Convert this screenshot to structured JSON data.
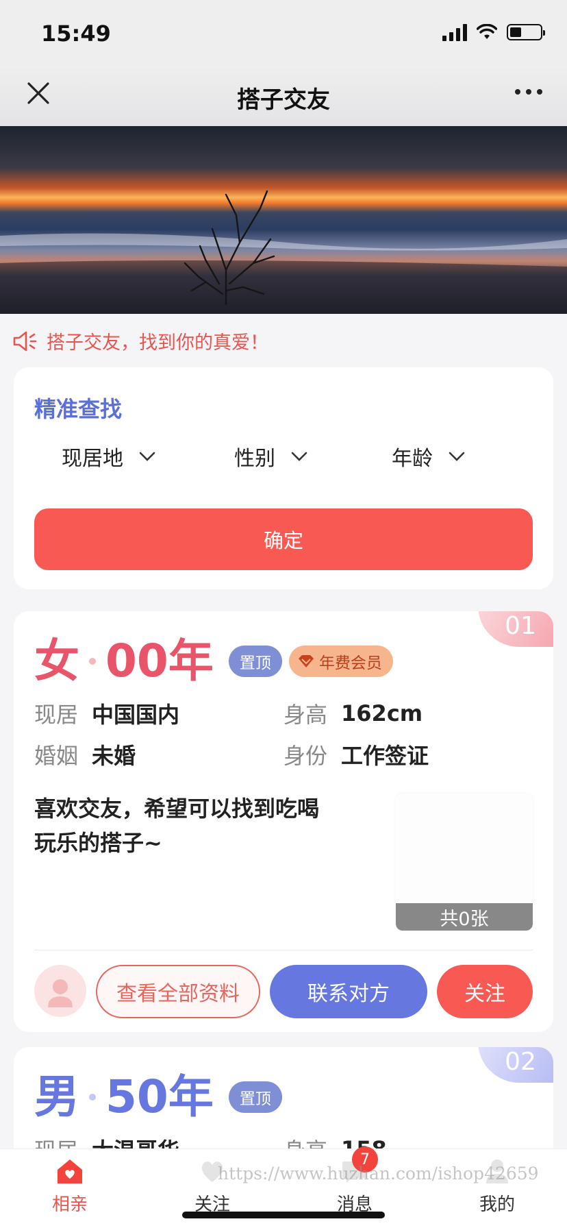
{
  "status_bar": {
    "time": "15:49"
  },
  "nav": {
    "title": "搭子交友"
  },
  "notice": {
    "text": "搭子交友，找到你的真爱！"
  },
  "search": {
    "title": "精准查找",
    "filters": [
      "现居地",
      "性别",
      "年龄"
    ],
    "confirm_label": "确定"
  },
  "profiles": [
    {
      "rank": "01",
      "gender": "女",
      "year": "00年",
      "accent": "#e8556b",
      "tags": {
        "top": "置顶",
        "vip": "年费会员"
      },
      "info": {
        "residence_label": "现居",
        "residence": "中国国内",
        "height_label": "身高",
        "height": "162cm",
        "marriage_label": "婚姻",
        "marriage": "未婚",
        "identity_label": "身份",
        "identity": "工作签证"
      },
      "intro": "喜欢交友，希望可以找到吃喝玩乐的搭子~",
      "photo_count": "共0张",
      "actions": {
        "view": "查看全部资料",
        "contact": "联系对方",
        "follow": "关注"
      }
    },
    {
      "rank": "02",
      "gender": "男",
      "year": "50年",
      "accent": "#6677e0",
      "tags": {
        "top": "置顶"
      },
      "info": {
        "residence_label": "现居",
        "residence": "大温哥华",
        "height_label": "身高",
        "height": "158"
      }
    }
  ],
  "tab_bar": {
    "items": [
      {
        "label": "相亲",
        "icon": "home-heart-icon"
      },
      {
        "label": "关注",
        "icon": "heart-icon"
      },
      {
        "label": "消息",
        "icon": "chat-icon",
        "badge": "7"
      },
      {
        "label": "我的",
        "icon": "user-icon"
      }
    ]
  },
  "watermark": "https://www.huzhan.com/ishop42659",
  "colors": {
    "primary_red": "#f85a53",
    "primary_blue": "#6677e0",
    "notice_red": "#e8554e"
  }
}
